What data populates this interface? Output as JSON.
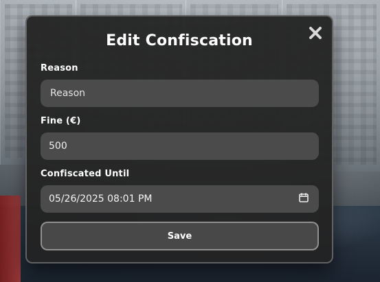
{
  "dialog": {
    "title": "Edit Confiscation",
    "close_icon": "close-icon"
  },
  "fields": {
    "reason": {
      "label": "Reason",
      "placeholder": "Reason",
      "value": ""
    },
    "fine": {
      "label": "Fine (€)",
      "value": "500"
    },
    "confiscated_until": {
      "label": "Confiscated Until",
      "value": "05/26/2025 08:01 PM",
      "icon": "calendar-icon"
    }
  },
  "actions": {
    "save_label": "Save"
  }
}
